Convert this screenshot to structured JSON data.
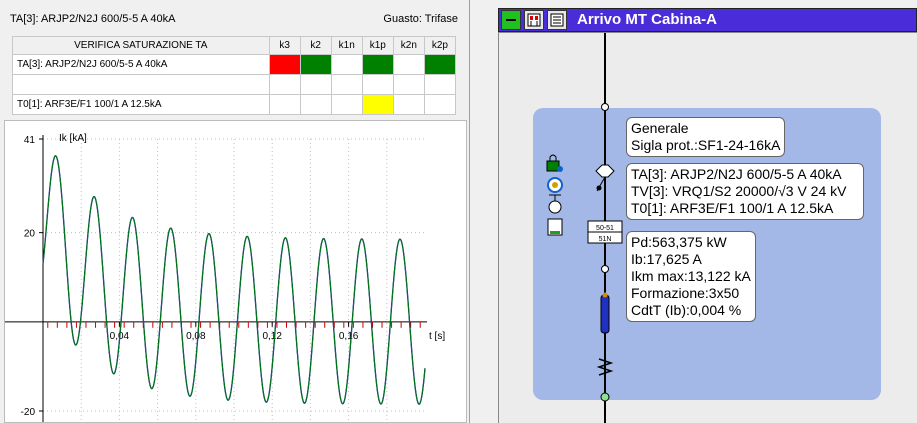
{
  "left": {
    "title": "TA[3]: ARJP2/N2J 600/5-5 A 40kA",
    "gusto": "Guasto: Trifase",
    "table": {
      "header": "VERIFICA SATURAZIONE TA",
      "columns": [
        "k3",
        "k2",
        "k1n",
        "k1p",
        "k2n",
        "k2p"
      ],
      "rows": [
        {
          "name": "TA[3]: ARJP2/N2J 600/5-5 A 40kA",
          "cells": [
            "red",
            "green",
            "empty",
            "green",
            "empty",
            "green"
          ]
        },
        {
          "name": "",
          "cells": [
            "empty",
            "empty",
            "empty",
            "empty",
            "empty",
            "empty"
          ]
        },
        {
          "name": "T0[1]: ARF3E/F1 100/1 A 12.5kA",
          "cells": [
            "empty",
            "empty",
            "empty",
            "yellow",
            "empty",
            "empty"
          ]
        }
      ]
    }
  },
  "chart_data": {
    "type": "line",
    "ylabel": "Ik [kA]",
    "xlabel": "t [s]",
    "ylim": [
      -20,
      41
    ],
    "xlim": [
      0,
      0.2
    ],
    "yticks": [
      "41",
      "20",
      "-20"
    ],
    "yticks_values": [
      41,
      20,
      -20
    ],
    "xticks": [
      "0,04",
      "0,08",
      "0,12",
      "0,16"
    ],
    "xticks_values": [
      0.04,
      0.08,
      0.12,
      0.16
    ],
    "series": [
      {
        "color": "#0000c0",
        "frequency": 50,
        "amplitude": 18.5,
        "dc_offset": 13,
        "dc_tau": 0.03
      },
      {
        "color": "#008000",
        "frequency": 50,
        "amplitude": 18.5,
        "dc_offset": 13,
        "dc_tau": 0.03
      }
    ]
  },
  "right": {
    "title": "Arrivo MT Cabina-A",
    "box1": [
      "Generale",
      "Sigla prot.:SF1-24-16kA"
    ],
    "box2": [
      "TA[3]: ARJP2/N2J 600/5-5 A 40kA",
      "TV[3]: VRQ1/S2 20000/√3 V 24 kV",
      "T0[1]: ARF3E/F1 100/1 A 12.5kA"
    ],
    "box3": [
      "Pd:563,375 kW",
      "Ib:17,625 A",
      "Ikm max:13,122 kA",
      "Formazione:3x50",
      "CdtT (Ib):0,004 %"
    ],
    "relay": [
      "50-51",
      "51N"
    ],
    "colors": {
      "toolbar": "#4a2cd8",
      "bay": "#a3b8e6",
      "cable": "#2030c0"
    }
  }
}
